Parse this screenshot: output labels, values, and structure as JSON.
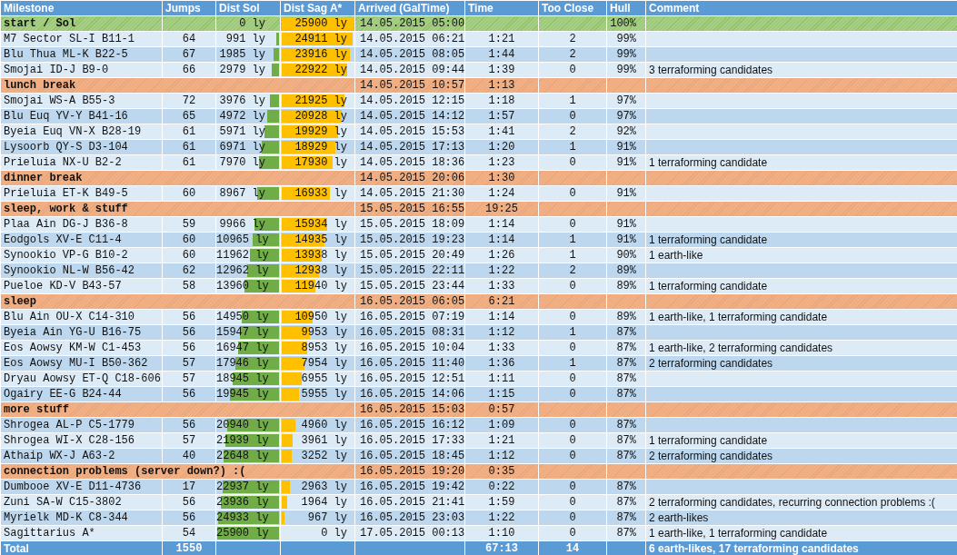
{
  "columns": [
    "Milestone",
    "Jumps",
    "Dist Sol",
    "Dist Sag A*",
    "Arrived (GalTime)",
    "Time",
    "Too Close",
    "Hull",
    "Comment"
  ],
  "rows": [
    {
      "kind": "start",
      "milestone": "start / Sol",
      "dist_sol": {
        "text": "0 ly",
        "level": 0
      },
      "dist_sag": {
        "text": "25900 ly",
        "level": 1
      },
      "arrived": "14.05.2015 05:00",
      "hull": "100%"
    },
    {
      "kind": "system",
      "milestone": "M7 Sector SL-I B11-1",
      "jumps": "64",
      "dist_sol": {
        "text": "991 ly",
        "level": 0.04
      },
      "dist_sag": {
        "text": "24911 ly",
        "level": 0.96
      },
      "arrived": "14.05.2015 06:21",
      "time": "1:21",
      "too_close": "2",
      "hull": "99%"
    },
    {
      "kind": "system",
      "milestone": "Blu Thua ML-K B22-5",
      "jumps": "67",
      "dist_sol": {
        "text": "1985 ly",
        "level": 0.08
      },
      "dist_sag": {
        "text": "23916 ly",
        "level": 0.92
      },
      "arrived": "14.05.2015 08:05",
      "time": "1:44",
      "too_close": "2",
      "hull": "99%"
    },
    {
      "kind": "system",
      "milestone": "Smojai ID-J B9-0",
      "jumps": "66",
      "dist_sol": {
        "text": "2979 ly",
        "level": 0.12
      },
      "dist_sag": {
        "text": "22922 ly",
        "level": 0.89
      },
      "arrived": "14.05.2015 09:44",
      "time": "1:39",
      "too_close": "0",
      "hull": "99%",
      "comment": "3 terraforming candidates"
    },
    {
      "kind": "break",
      "milestone": "lunch break",
      "arrived": "14.05.2015 10:57",
      "time": "1:13"
    },
    {
      "kind": "system",
      "milestone": "Smojai WS-A B55-3",
      "jumps": "72",
      "dist_sol": {
        "text": "3976 ly",
        "level": 0.15
      },
      "dist_sag": {
        "text": "21925 ly",
        "level": 0.85
      },
      "arrived": "14.05.2015 12:15",
      "time": "1:18",
      "too_close": "1",
      "hull": "97%"
    },
    {
      "kind": "system",
      "milestone": "Blu Euq YV-Y B41-16",
      "jumps": "65",
      "dist_sol": {
        "text": "4972 ly",
        "level": 0.19
      },
      "dist_sag": {
        "text": "20928 ly",
        "level": 0.81
      },
      "arrived": "14.05.2015 14:12",
      "time": "1:57",
      "too_close": "0",
      "hull": "97%"
    },
    {
      "kind": "system",
      "milestone": "Byeia Euq VN-X B28-19",
      "jumps": "61",
      "dist_sol": {
        "text": "5971 ly",
        "level": 0.23
      },
      "dist_sag": {
        "text": "19929 ly",
        "level": 0.77
      },
      "arrived": "14.05.2015 15:53",
      "time": "1:41",
      "too_close": "2",
      "hull": "92%"
    },
    {
      "kind": "system",
      "milestone": "Lysoorb QY-S D3-104",
      "jumps": "61",
      "dist_sol": {
        "text": "6971 ly",
        "level": 0.27
      },
      "dist_sag": {
        "text": "18929 ly",
        "level": 0.73
      },
      "arrived": "14.05.2015 17:13",
      "time": "1:20",
      "too_close": "1",
      "hull": "91%"
    },
    {
      "kind": "system",
      "milestone": "Prieluia NX-U B2-2",
      "jumps": "61",
      "dist_sol": {
        "text": "7970 ly",
        "level": 0.31
      },
      "dist_sag": {
        "text": "17930 ly",
        "level": 0.69
      },
      "arrived": "14.05.2015 18:36",
      "time": "1:23",
      "too_close": "0",
      "hull": "91%",
      "comment": "1 terraforming candidate"
    },
    {
      "kind": "break",
      "milestone": "dinner break",
      "arrived": "14.05.2015 20:06",
      "time": "1:30"
    },
    {
      "kind": "system",
      "milestone": "Prieluia ET-K B49-5",
      "jumps": "60",
      "dist_sol": {
        "text": "8967 ly",
        "level": 0.35
      },
      "dist_sag": {
        "text": "16933 ly",
        "level": 0.65
      },
      "arrived": "14.05.2015 21:30",
      "time": "1:24",
      "too_close": "0",
      "hull": "91%"
    },
    {
      "kind": "break",
      "milestone": "sleep, work & stuff",
      "arrived": "15.05.2015 16:55",
      "time": "19:25"
    },
    {
      "kind": "system",
      "milestone": "Plaa Ain DG-J B36-8",
      "jumps": "59",
      "dist_sol": {
        "text": "9966 ly",
        "level": 0.38
      },
      "dist_sag": {
        "text": "15934 ly",
        "level": 0.62
      },
      "arrived": "15.05.2015 18:09",
      "time": "1:14",
      "too_close": "0",
      "hull": "91%"
    },
    {
      "kind": "system",
      "milestone": "Eodgols XV-E C11-4",
      "jumps": "60",
      "dist_sol": {
        "text": "10965 ly",
        "level": 0.42
      },
      "dist_sag": {
        "text": "14935 ly",
        "level": 0.58
      },
      "arrived": "15.05.2015 19:23",
      "time": "1:14",
      "too_close": "1",
      "hull": "91%",
      "comment": "1 terraforming candidate"
    },
    {
      "kind": "system",
      "milestone": "Synookio VP-G B10-2",
      "jumps": "60",
      "dist_sol": {
        "text": "11962 ly",
        "level": 0.46
      },
      "dist_sag": {
        "text": "13938 ly",
        "level": 0.54
      },
      "arrived": "15.05.2015 20:49",
      "time": "1:26",
      "too_close": "1",
      "hull": "90%",
      "comment": "1 earth-like"
    },
    {
      "kind": "system",
      "milestone": "Synookio NL-W B56-42",
      "jumps": "62",
      "dist_sol": {
        "text": "12962 ly",
        "level": 0.5
      },
      "dist_sag": {
        "text": "12938 ly",
        "level": 0.5
      },
      "arrived": "15.05.2015 22:11",
      "time": "1:22",
      "too_close": "2",
      "hull": "89%"
    },
    {
      "kind": "system",
      "milestone": "Pueloe KD-V B43-57",
      "jumps": "58",
      "dist_sol": {
        "text": "13960 ly",
        "level": 0.54
      },
      "dist_sag": {
        "text": "11940 ly",
        "level": 0.46
      },
      "arrived": "15.05.2015 23:44",
      "time": "1:33",
      "too_close": "0",
      "hull": "89%",
      "comment": "1 terraforming candidate"
    },
    {
      "kind": "break",
      "milestone": "sleep",
      "arrived": "16.05.2015 06:05",
      "time": "6:21"
    },
    {
      "kind": "system",
      "milestone": "Blu Ain OU-X C14-310",
      "jumps": "56",
      "dist_sol": {
        "text": "14950 ly",
        "level": 0.58
      },
      "dist_sag": {
        "text": "10950 ly",
        "level": 0.42
      },
      "arrived": "16.05.2015 07:19",
      "time": "1:14",
      "too_close": "0",
      "hull": "89%",
      "comment": "1 earth-like, 1 terraforming candidate"
    },
    {
      "kind": "system",
      "milestone": "Byeia Ain YG-U B16-75",
      "jumps": "56",
      "dist_sol": {
        "text": "15947 ly",
        "level": 0.62
      },
      "dist_sag": {
        "text": "9953 ly",
        "level": 0.38
      },
      "arrived": "16.05.2015 08:31",
      "time": "1:12",
      "too_close": "1",
      "hull": "87%"
    },
    {
      "kind": "system",
      "milestone": "Eos Aowsy KM-W C1-453",
      "jumps": "56",
      "dist_sol": {
        "text": "16947 ly",
        "level": 0.65
      },
      "dist_sag": {
        "text": "8953 ly",
        "level": 0.35
      },
      "arrived": "16.05.2015 10:04",
      "time": "1:33",
      "too_close": "0",
      "hull": "87%",
      "comment": "1 earth-like, 2 terraforming candidates"
    },
    {
      "kind": "system",
      "milestone": "Eos Aowsy MU-I B50-362",
      "jumps": "57",
      "dist_sol": {
        "text": "17946 ly",
        "level": 0.69
      },
      "dist_sag": {
        "text": "7954 ly",
        "level": 0.31
      },
      "arrived": "16.05.2015 11:40",
      "time": "1:36",
      "too_close": "1",
      "hull": "87%",
      "comment": "2 terraforming candidates"
    },
    {
      "kind": "system",
      "milestone": "Dryau Aowsy ET-Q C18-606",
      "jumps": "57",
      "dist_sol": {
        "text": "18945 ly",
        "level": 0.73
      },
      "dist_sag": {
        "text": "6955 ly",
        "level": 0.27
      },
      "arrived": "16.05.2015 12:51",
      "time": "1:11",
      "too_close": "0",
      "hull": "87%"
    },
    {
      "kind": "system",
      "milestone": "Ogairy EE-G B24-44",
      "jumps": "56",
      "dist_sol": {
        "text": "19945 ly",
        "level": 0.77
      },
      "dist_sag": {
        "text": "5955 ly",
        "level": 0.23
      },
      "arrived": "16.05.2015 14:06",
      "time": "1:15",
      "too_close": "0",
      "hull": "87%"
    },
    {
      "kind": "break",
      "milestone": "more stuff",
      "arrived": "16.05.2015 15:03",
      "time": "0:57"
    },
    {
      "kind": "system",
      "milestone": "Shrogea AL-P C5-1779",
      "jumps": "56",
      "dist_sol": {
        "text": "20940 ly",
        "level": 0.81
      },
      "dist_sag": {
        "text": "4960 ly",
        "level": 0.19
      },
      "arrived": "16.05.2015 16:12",
      "time": "1:09",
      "too_close": "0",
      "hull": "87%"
    },
    {
      "kind": "system",
      "milestone": "Shrogea WI-X C28-156",
      "jumps": "57",
      "dist_sol": {
        "text": "21939 ly",
        "level": 0.85
      },
      "dist_sag": {
        "text": "3961 ly",
        "level": 0.15
      },
      "arrived": "16.05.2015 17:33",
      "time": "1:21",
      "too_close": "0",
      "hull": "87%",
      "comment": "1 terraforming candidate"
    },
    {
      "kind": "system",
      "milestone": "Athaip WX-J A63-2",
      "jumps": "40",
      "dist_sol": {
        "text": "22648 ly",
        "level": 0.87
      },
      "dist_sag": {
        "text": "3252 ly",
        "level": 0.13
      },
      "arrived": "16.05.2015 18:45",
      "time": "1:12",
      "too_close": "0",
      "hull": "87%",
      "comment": "2 terraforming candidates"
    },
    {
      "kind": "break",
      "milestone": "connection problems (server down?) :(",
      "arrived": "16.05.2015 19:20",
      "time": "0:35"
    },
    {
      "kind": "system",
      "milestone": "Dumbooe XV-E D11-4736",
      "jumps": "17",
      "dist_sol": {
        "text": "22937 ly",
        "level": 0.89
      },
      "dist_sag": {
        "text": "2963 ly",
        "level": 0.11
      },
      "arrived": "16.05.2015 19:42",
      "time": "0:22",
      "too_close": "0",
      "hull": "87%"
    },
    {
      "kind": "system",
      "milestone": "Zuni SA-W C15-3802",
      "jumps": "56",
      "dist_sol": {
        "text": "23936 ly",
        "level": 0.92
      },
      "dist_sag": {
        "text": "1964 ly",
        "level": 0.08
      },
      "arrived": "16.05.2015 21:41",
      "time": "1:59",
      "too_close": "0",
      "hull": "87%",
      "comment": "2 terraforming candidates, recurring connection problems :("
    },
    {
      "kind": "system",
      "milestone": "Myrielk MD-K C8-344",
      "jumps": "56",
      "dist_sol": {
        "text": "24933 ly",
        "level": 0.96
      },
      "dist_sag": {
        "text": "967 ly",
        "level": 0.04
      },
      "arrived": "16.05.2015 23:03",
      "time": "1:22",
      "too_close": "0",
      "hull": "87%",
      "comment": "2 earth-likes"
    },
    {
      "kind": "system",
      "milestone": "Sagittarius A*",
      "jumps": "54",
      "dist_sol": {
        "text": "25900 ly",
        "level": 1
      },
      "dist_sag": {
        "text": "0 ly",
        "level": 0
      },
      "arrived": "17.05.2015 00:13",
      "time": "1:10",
      "too_close": "0",
      "hull": "87%",
      "comment": "1 earth-like, 1 terraforming candidate"
    }
  ],
  "total": {
    "milestone": "Total",
    "jumps": "1550",
    "time": "67:13",
    "too_close": "14",
    "comment": "6 earth-likes, 17 terraforming candidates"
  }
}
